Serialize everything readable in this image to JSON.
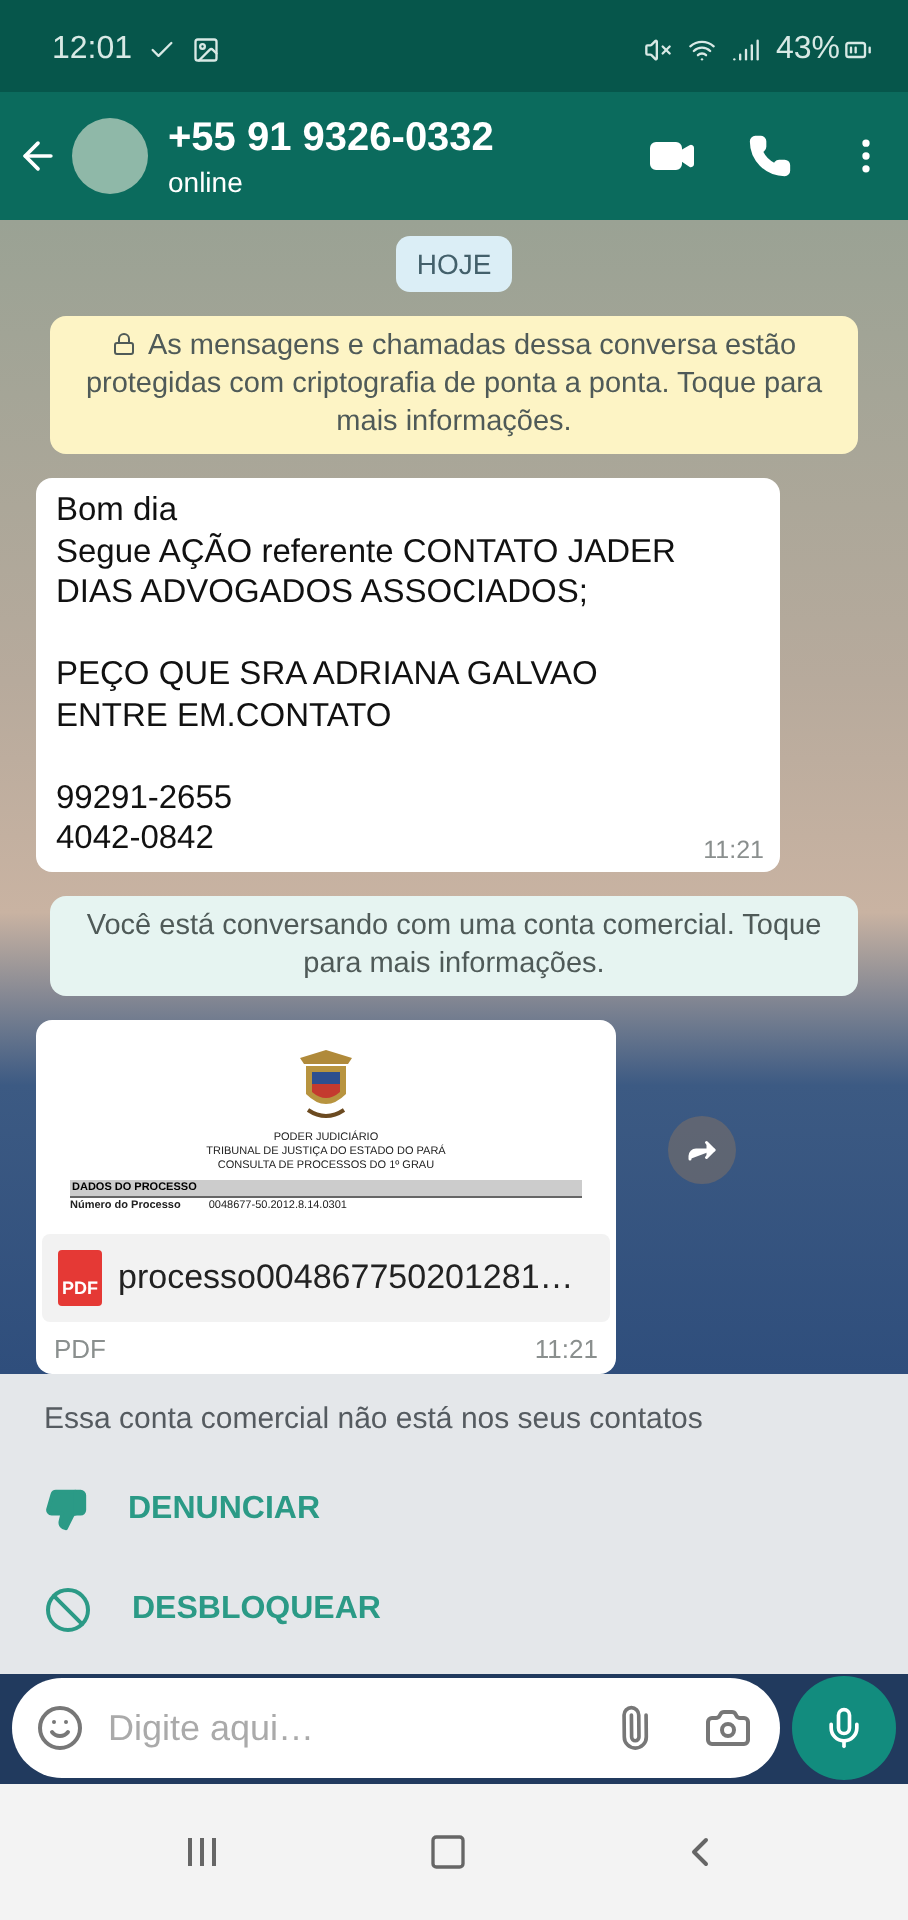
{
  "status_bar": {
    "time": "12:01",
    "battery": "43%"
  },
  "header": {
    "title": "+55 91 9326-0332",
    "subtitle": "online"
  },
  "chat": [
    {
      "kind": "date",
      "text": "HOJE"
    },
    {
      "kind": "lock_notice",
      "color": "#fdf4c5",
      "text": "As mensagens e chamadas dessa conversa estão protegidas com criptografia de ponta a ponta. Toque para mais informações."
    },
    {
      "kind": "text",
      "text": "Bom dia\nSegue AÇÃO referente CONTATO JADER DIAS ADVOGADOS ASSOCIADOS;\n\nPEÇO QUE SRA ADRIANA GALVAO ENTRE EM.CONTATO\n\n99291-2655\n4042-0842",
      "time": "11:21"
    },
    {
      "kind": "notice",
      "color": "#e6f4f1",
      "text": "Você está conversando com uma conta comercial. Toque para mais informações."
    },
    {
      "kind": "document",
      "preview": {
        "heading": [
          "PODER JUDICIÁRIO",
          "TRIBUNAL DE JUSTIÇA DO ESTADO DO PARÁ",
          "CONSULTA DE PROCESSOS DO 1º GRAU"
        ],
        "section": "DADOS DO PROCESSO",
        "field_label": "Número do Processo",
        "field_value": "0048677-50.2012.8.14.0301"
      },
      "badge": "PDF",
      "filename": "processo004867750201281…",
      "type": "PDF",
      "time": "11:21"
    }
  ],
  "panel": {
    "text": "Essa conta comercial não está nos seus contatos",
    "actions": [
      {
        "kind": "report",
        "label": "DENUNCIAR"
      },
      {
        "kind": "unblock",
        "label": "DESBLOQUEAR"
      }
    ]
  },
  "composer": {
    "placeholder": "Digite aqui…"
  }
}
